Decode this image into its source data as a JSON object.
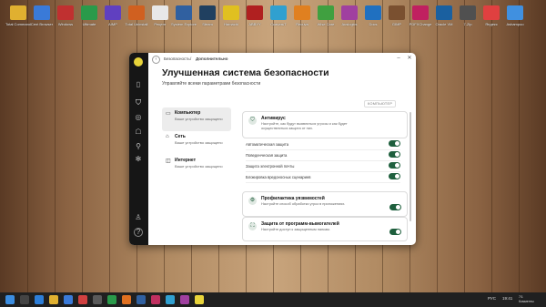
{
  "desktop": {
    "icons_top_row": [
      "Total Commander",
      "Cent Browser",
      "Windows",
      "Ultimate",
      "AIMP",
      "Total Uninstall",
      "Рецепт",
      "System Explorer",
      "Steam",
      "Hamachi",
      "ABBYY",
      "СкачатьТ",
      "Recuva",
      "Wise Care",
      "Auslogics",
      "Docs",
      "GIMP",
      "PDFXChange",
      "Oracle VM",
      "7-Zip",
      "Яндекс",
      "Ashampoo"
    ],
    "icon_colors": [
      "#e0b030",
      "#3a7ad8",
      "#c03030",
      "#2a9a4a",
      "#6040c0",
      "#d06020",
      "#e8e8e8",
      "#3060a0",
      "#204060",
      "#e0c020",
      "#b02020",
      "#30a0d0",
      "#e08020",
      "#40a040",
      "#a040a0",
      "#2070c0",
      "#7a5030",
      "#c02060",
      "#1a60a0",
      "#505050",
      "#e04040",
      "#4090e0"
    ]
  },
  "window": {
    "breadcrumb_root": "Безопасность",
    "breadcrumb_current": "Дополнительно",
    "title": "Улучшенная система безопасности",
    "subtitle": "Управляйте всеми параметрами безопасности",
    "section_tag": "КОМПЬЮТЕР",
    "nav": [
      {
        "title": "Компьютер",
        "desc": "Ваше устройство защищено"
      },
      {
        "title": "Сеть",
        "desc": "Ваше устройство защищено"
      },
      {
        "title": "Интернет",
        "desc": "Ваше устройство защищено"
      }
    ],
    "antivirus": {
      "title": "Антивирус",
      "desc": "Настройте, как будут выявляться угрозы и как будет осуществляться защита от них."
    },
    "antivirus_rows": [
      "Автоматическая защита",
      "Поведенческая защита",
      "Защита электронной почты",
      "Блокировка вредоносных сценариев"
    ],
    "prevention": {
      "title": "Профилактика уязвимостей",
      "desc": "Настройте способ обработки угроз в приложениях."
    },
    "ransomware": {
      "title": "Защита от программ-вымогателей",
      "desc": "Настройте доступ к защищенным папкам."
    },
    "toggles_on": [
      true,
      true,
      true,
      true,
      true,
      true
    ]
  },
  "taskbar": {
    "lang": "РУС",
    "time": "19:41",
    "date": "7/1",
    "notification_label": "Комменты"
  },
  "colors": {
    "accent": "#1e5f3d",
    "rail": "#161616",
    "taskbar": "#202020"
  }
}
